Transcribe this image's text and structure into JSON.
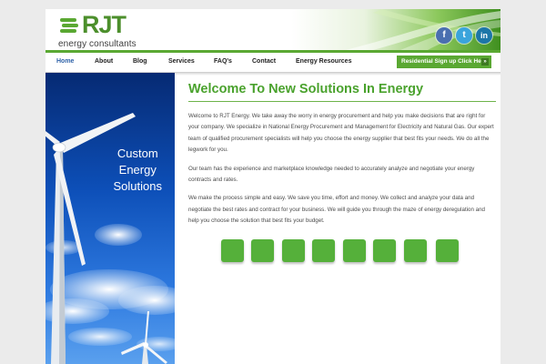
{
  "header": {
    "logo_text": "RJT",
    "logo_tagline": "energy consultants",
    "social": [
      {
        "icon": "facebook-icon",
        "label": "f"
      },
      {
        "icon": "twitter-icon",
        "label": "t"
      },
      {
        "icon": "linkedin-icon",
        "label": "in"
      }
    ]
  },
  "nav": {
    "items": [
      {
        "label": "Home",
        "active": true
      },
      {
        "label": "About"
      },
      {
        "label": "Blog"
      },
      {
        "label": "Services"
      },
      {
        "label": "FAQ's"
      },
      {
        "label": "Contact"
      },
      {
        "label": "Energy Resources"
      }
    ],
    "cta_label": "Residential Sign up Click Here",
    "cta_arrow": "»"
  },
  "hero": {
    "lines": [
      "Custom",
      "Energy",
      "Solutions"
    ]
  },
  "main": {
    "title": "Welcome To New Solutions In Energy",
    "paragraphs": [
      "Welcome to RJT Energy. We take away the worry in energy procurement and help you make decisions that are right for your company. We specialize in National Energy Procurement and Management for Electricity and Natural Gas. Our expert team of qualified procurement specialists will help you choose the energy supplier that best fits your needs. We do all the legwork for you.",
      "Our team has the experience and marketplace knowledge needed to accurately analyze and negotiate your energy contracts and rates.",
      "We make the process simple and easy. We save you time, effort and money. We collect and analyze your data and negotiate the best rates and contract for your business. We will guide you through the maze of energy deregulation and help you choose the solution that best fits your budget."
    ],
    "tile_count": 8
  },
  "colors": {
    "brand_green": "#5aa832",
    "title_green": "#4aa22d",
    "nav_active": "#2f62a8",
    "tile_green": "#55b03a"
  }
}
